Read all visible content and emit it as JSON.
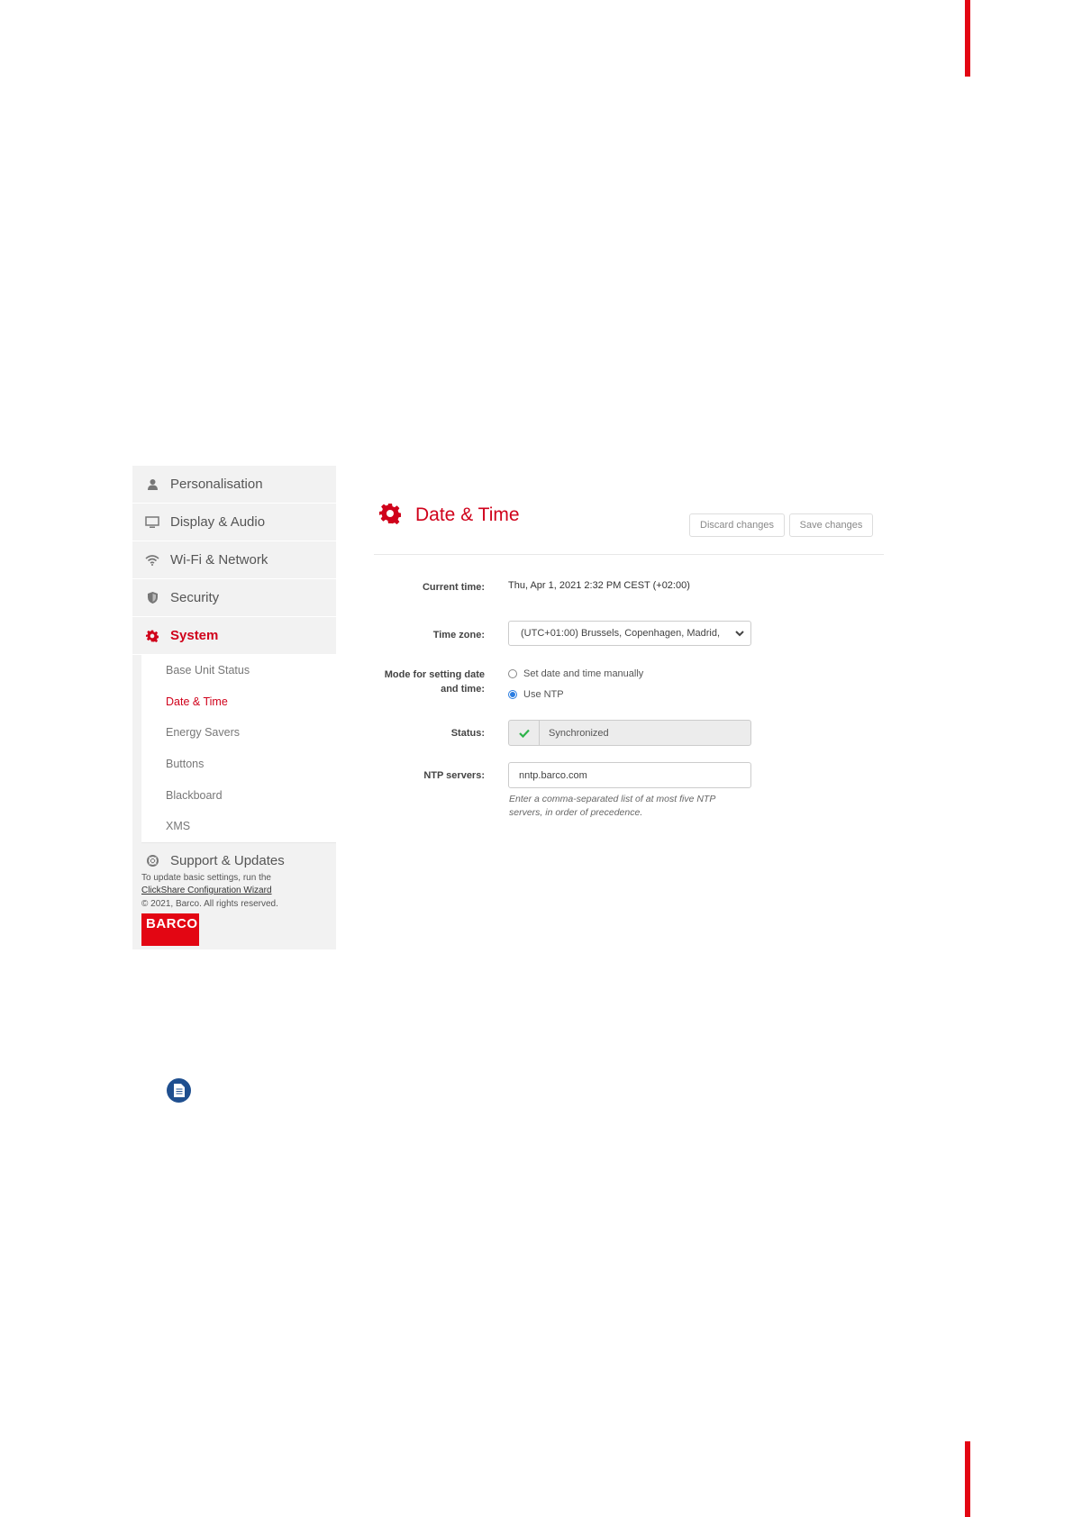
{
  "sidebar": {
    "items": [
      {
        "label": "Personalisation",
        "icon": "user-icon"
      },
      {
        "label": "Display & Audio",
        "icon": "monitor-icon"
      },
      {
        "label": "Wi-Fi & Network",
        "icon": "wifi-icon"
      },
      {
        "label": "Security",
        "icon": "shield-icon"
      },
      {
        "label": "System",
        "icon": "gear-icon",
        "active": true
      }
    ],
    "subitems": [
      {
        "label": "Base Unit Status"
      },
      {
        "label": "Date & Time",
        "active": true
      },
      {
        "label": "Energy Savers"
      },
      {
        "label": "Buttons"
      },
      {
        "label": "Blackboard"
      },
      {
        "label": "XMS"
      }
    ],
    "support": {
      "label": "Support & Updates",
      "icon": "lifebuoy-icon"
    },
    "footer": {
      "line1": "To update basic settings, run the",
      "link": "ClickShare Configuration Wizard",
      "copyright": "© 2021, Barco. All rights reserved."
    },
    "logo_text": "BARCO"
  },
  "main": {
    "title": "Date & Time",
    "discard_label": "Discard changes",
    "save_label": "Save changes",
    "current_time_label": "Current time:",
    "current_time_value": "Thu, Apr 1, 2021 2:32 PM CEST (+02:00)",
    "timezone_label": "Time zone:",
    "timezone_value": "(UTC+01:00) Brussels, Copenhagen, Madrid,",
    "mode_label_line1": "Mode for setting date",
    "mode_label_line2": "and time:",
    "mode_options": [
      "Set date and time manually",
      "Use NTP"
    ],
    "mode_selected": "Use NTP",
    "status_label": "Status:",
    "status_value": "Synchronized",
    "ntp_label": "NTP servers:",
    "ntp_value": "nntp.barco.com",
    "ntp_hint_line1": "Enter a comma-separated list of at most five NTP",
    "ntp_hint_line2": "servers, in order of precedence."
  },
  "colors": {
    "accent": "#d0021b",
    "brand_red": "#e30613",
    "radio_blue": "#2a7de1",
    "check_green": "#2db34a",
    "note_blue": "#1f4f8f"
  }
}
